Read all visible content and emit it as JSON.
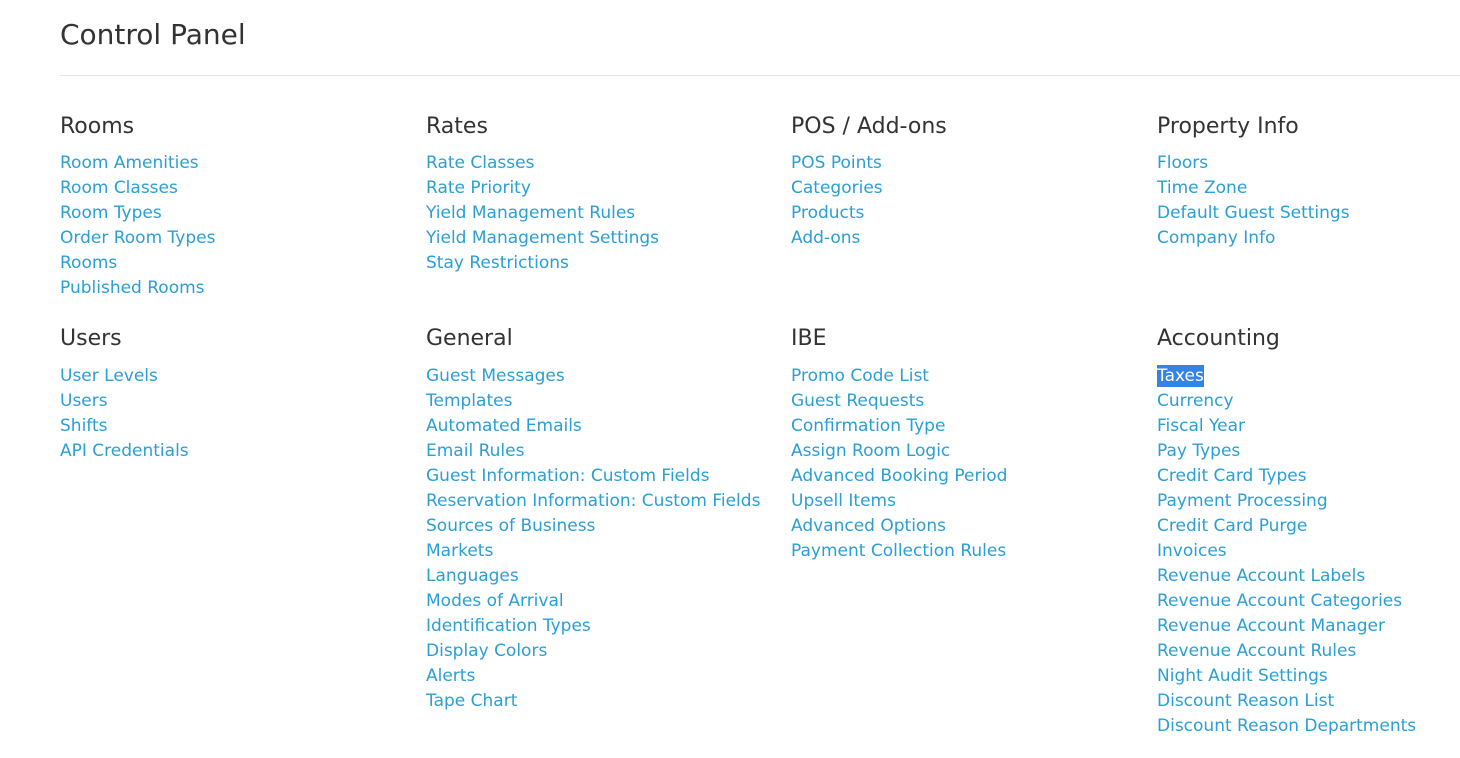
{
  "page": {
    "title": "Control Panel"
  },
  "colors": {
    "link": "#2a9fd6",
    "heading": "#333333",
    "divider": "#e5e5e5",
    "selection_bg": "#3584e4"
  },
  "sections": {
    "rooms": {
      "heading": "Rooms",
      "links": [
        "Room Amenities",
        "Room Classes",
        "Room Types",
        "Order Room Types",
        "Rooms",
        "Published Rooms"
      ]
    },
    "rates": {
      "heading": "Rates",
      "links": [
        "Rate Classes",
        "Rate Priority",
        "Yield Management Rules",
        "Yield Management Settings",
        "Stay Restrictions"
      ]
    },
    "pos": {
      "heading": "POS / Add-ons",
      "links": [
        "POS Points",
        "Categories",
        "Products",
        "Add-ons"
      ]
    },
    "property": {
      "heading": "Property Info",
      "links": [
        "Floors",
        "Time Zone",
        "Default Guest Settings",
        "Company Info"
      ]
    },
    "users": {
      "heading": "Users",
      "links": [
        "User Levels",
        "Users",
        "Shifts",
        "API Credentials"
      ]
    },
    "general": {
      "heading": "General",
      "links": [
        "Guest Messages",
        "Templates",
        "Automated Emails",
        "Email Rules",
        "Guest Information: Custom Fields",
        "Reservation Information: Custom Fields",
        "Sources of Business",
        "Markets",
        "Languages",
        "Modes of Arrival",
        "Identification Types",
        "Display Colors",
        "Alerts",
        "Tape Chart"
      ]
    },
    "ibe": {
      "heading": "IBE",
      "links": [
        "Promo Code List",
        "Guest Requests",
        "Confirmation Type",
        "Assign Room Logic",
        "Advanced Booking Period",
        "Upsell Items",
        "Advanced Options",
        "Payment Collection Rules"
      ]
    },
    "accounting": {
      "heading": "Accounting",
      "links": [
        "Taxes",
        "Currency",
        "Fiscal Year",
        "Pay Types",
        "Credit Card Types",
        "Payment Processing",
        "Credit Card Purge",
        "Invoices",
        "Revenue Account Labels",
        "Revenue Account Categories",
        "Revenue Account Manager",
        "Revenue Account Rules",
        "Night Audit Settings",
        "Discount Reason List",
        "Discount Reason Departments"
      ],
      "selected_link": "Taxes"
    }
  }
}
